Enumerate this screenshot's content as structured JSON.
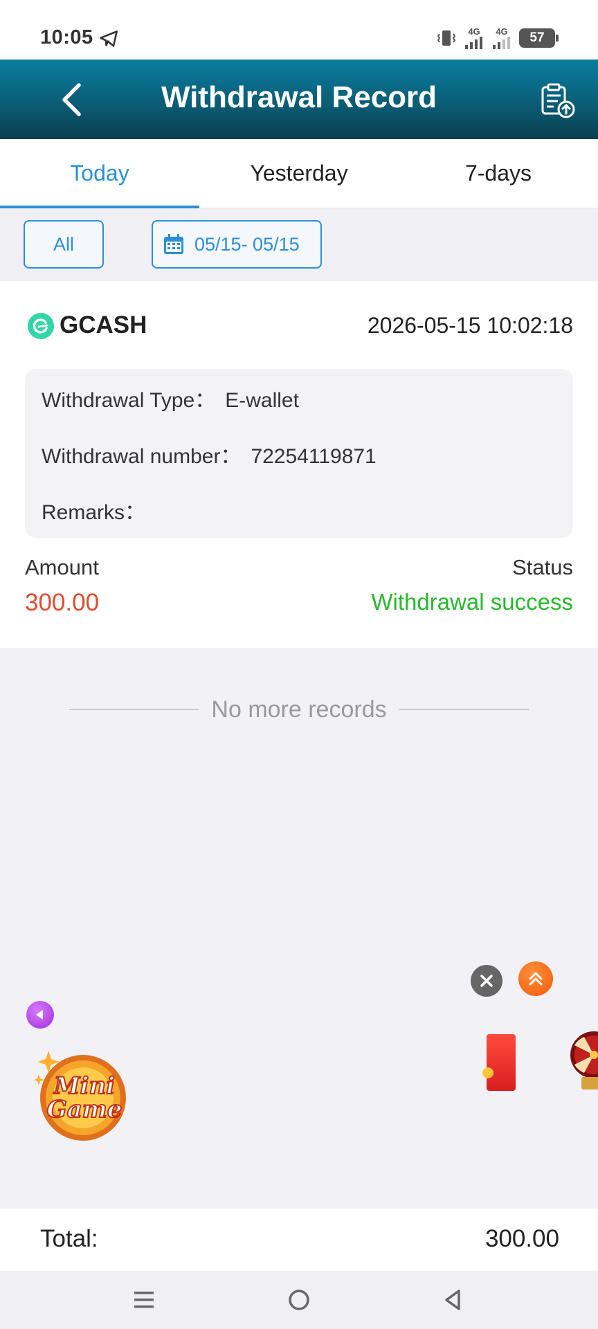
{
  "status_bar": {
    "time": "10:05",
    "battery": "57",
    "network_1": "4G",
    "network_2": "4G"
  },
  "header": {
    "title": "Withdrawal Record"
  },
  "tabs": [
    {
      "label": "Today",
      "active": true
    },
    {
      "label": "Yesterday",
      "active": false
    },
    {
      "label": "7-days",
      "active": false
    }
  ],
  "filters": {
    "all_label": "All",
    "date_range": "05/15- 05/15"
  },
  "record": {
    "method": "GCASH",
    "datetime": "2026-05-15 10:02:18",
    "type_label": "Withdrawal Type：",
    "type_value": "E-wallet",
    "number_label": "Withdrawal number：",
    "number_value": "72254119871",
    "remarks_label": "Remarks：",
    "remarks_value": "",
    "amount_label": "Amount",
    "amount_value": "300.00",
    "status_label": "Status",
    "status_value": "Withdrawal success"
  },
  "list_end_text": "No more records",
  "floating": {
    "mini_game_line1": "Mini",
    "mini_game_line2": "Game"
  },
  "footer": {
    "total_label": "Total:",
    "total_value": "300.00"
  },
  "colors": {
    "accent": "#2b8fd6",
    "amount": "#e24a2c",
    "success": "#25b92a",
    "header_dark": "#0a3e50"
  }
}
